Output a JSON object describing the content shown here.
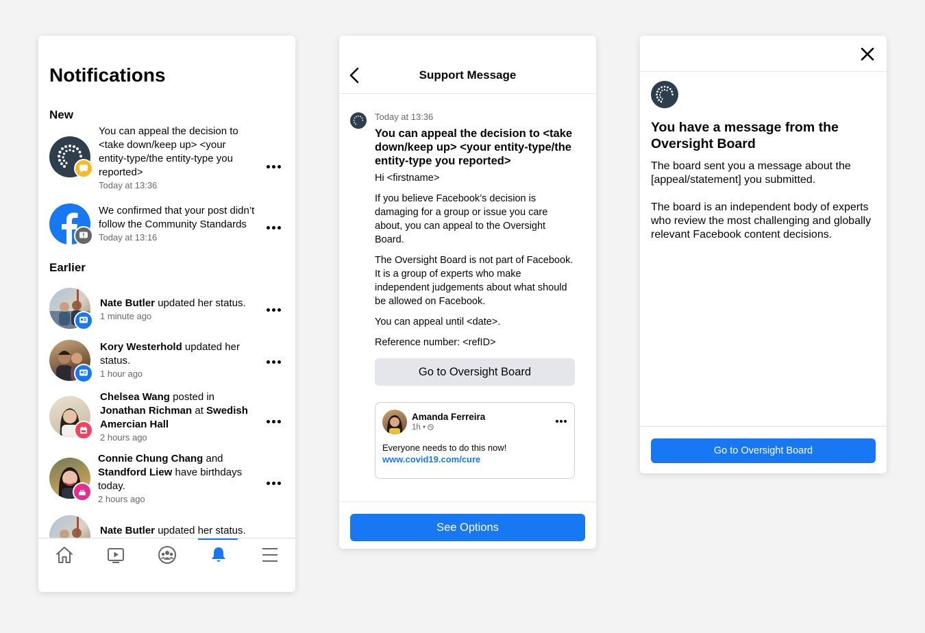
{
  "notifications": {
    "title": "Notifications",
    "section_new": "New",
    "section_earlier": "Earlier",
    "items": [
      {
        "text": "You can appeal the decision to <take down/keep up> <your entity-type/the entity-type you reported>",
        "time": "Today at 13:36"
      },
      {
        "text": "We confirmed that your post didn’t follow the Community Standards",
        "time": "Today at 13:16"
      },
      {
        "name": "Nate Butler",
        "rest": " updated her status.",
        "time": "1 minute ago"
      },
      {
        "name": "Kory Westerhold",
        "rest": " updated her status.",
        "time": "1 hour ago"
      },
      {
        "name": "Chelsea Wang",
        "rest1": " posted in ",
        "name2": "Jonathan Richman",
        "rest2": " at ",
        "name3": "Swedish Amercian Hall",
        "time": "2 hours ago"
      },
      {
        "name": "Connie Chung Chang",
        "rest1": " and ",
        "name2": "Standford Liew",
        "rest2": " have birthdays today.",
        "time": "2 hours ago"
      },
      {
        "name": "Nate Butler",
        "rest": " updated her status."
      }
    ],
    "tabs": [
      "home-icon",
      "video-icon",
      "groups-icon",
      "bell-icon",
      "menu-icon"
    ],
    "active_tab": "bell-icon",
    "accent": "#1877f2"
  },
  "support": {
    "header_title": "Support Message",
    "time": "Today at 13:36",
    "title": "You can appeal the decision to <take down/keep up> <your entity-type/the entity-type you reported>",
    "greeting": "Hi <firstname>",
    "para1": "If you believe Facebook’s decision is damaging for a group or issue you care about, you can appeal to the Oversight Board.",
    "para2": "The Oversight Board is not part of Facebook. It is a group of experts who make independent judgements about what should be allowed on Facebook.",
    "para3": "You can appeal until <date>.",
    "para4": "Reference number: <refID>",
    "go_button": "Go to Oversight Board",
    "post": {
      "author": "Amanda Ferreira",
      "meta": "1h •",
      "text": "Everyone needs to do this now!",
      "link": "www.covid19.com/cure"
    },
    "see_options": "See Options"
  },
  "dialog": {
    "title": "You have a message from the Oversight Board",
    "body1": "The board sent you a message about the [appeal/statement] you submitted.",
    "body2": "The board is an independent body of experts who review the most challenging and globally relevant Facebook content decisions.",
    "button": "Go to Oversight Board"
  }
}
